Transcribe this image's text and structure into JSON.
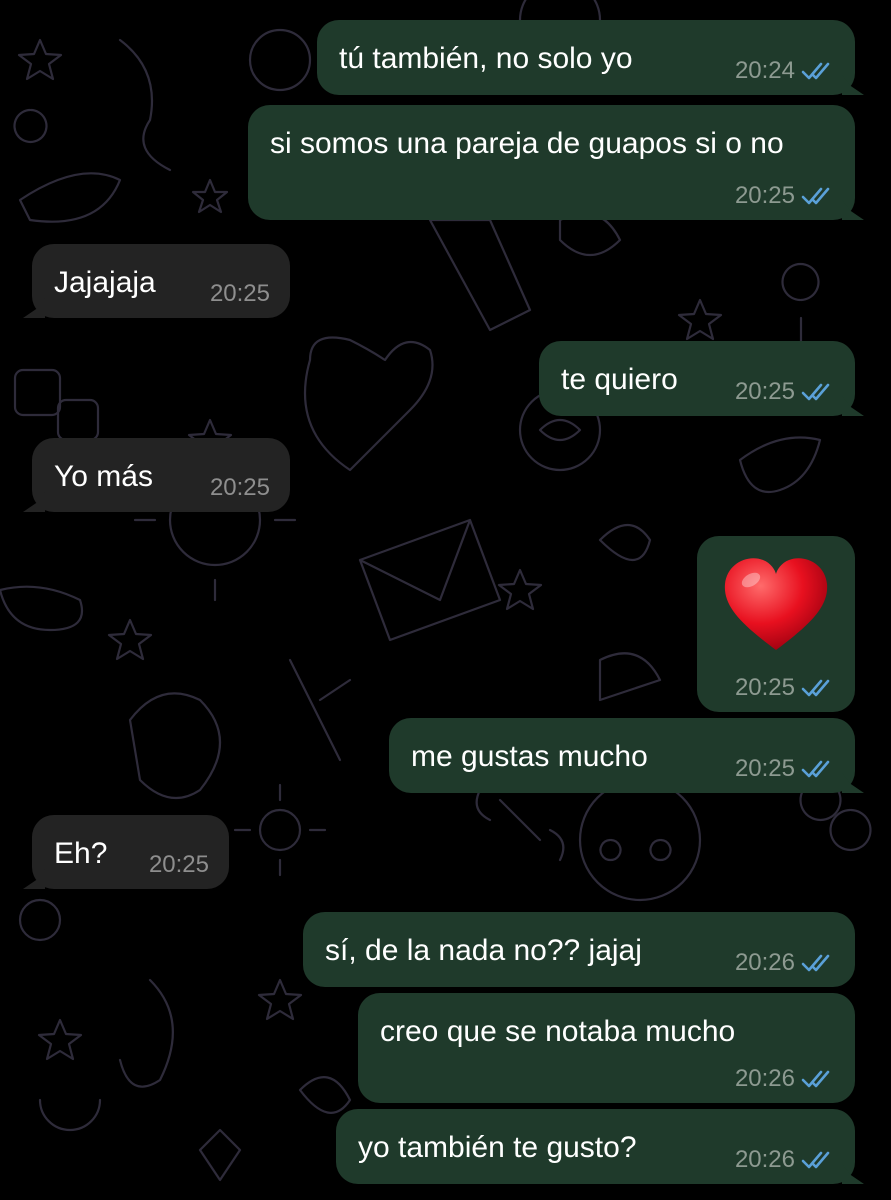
{
  "colors": {
    "outgoing_bubble": "#1f3a2b",
    "incoming_bubble": "#232323",
    "read_ticks": "#5aa0d8",
    "background": "#000000"
  },
  "messages": [
    {
      "direction": "outgoing",
      "text": "tú también, no solo yo",
      "time": "20:24",
      "status": "read-double-check-icon"
    },
    {
      "direction": "outgoing",
      "text": "si somos una pareja de guapos si o no",
      "time": "20:25",
      "status": "read-double-check-icon"
    },
    {
      "direction": "incoming",
      "text": "Jajajaja",
      "time": "20:25"
    },
    {
      "direction": "outgoing",
      "text": "te quiero",
      "time": "20:25",
      "status": "read-double-check-icon"
    },
    {
      "direction": "incoming",
      "text": "Yo más",
      "time": "20:25"
    },
    {
      "direction": "outgoing",
      "text": "",
      "emoji": "red-heart-emoji",
      "time": "20:25",
      "status": "read-double-check-icon"
    },
    {
      "direction": "outgoing",
      "text": "me gustas mucho",
      "time": "20:25",
      "status": "read-double-check-icon"
    },
    {
      "direction": "incoming",
      "text": "Eh?",
      "time": "20:25"
    },
    {
      "direction": "outgoing",
      "text": "sí, de la nada no?? jajaj",
      "time": "20:26",
      "status": "read-double-check-icon"
    },
    {
      "direction": "outgoing",
      "text": "creo que se notaba mucho",
      "time": "20:26",
      "status": "read-double-check-icon"
    },
    {
      "direction": "outgoing",
      "text": "yo también te gusto?",
      "time": "20:26",
      "status": "read-double-check-icon"
    }
  ]
}
